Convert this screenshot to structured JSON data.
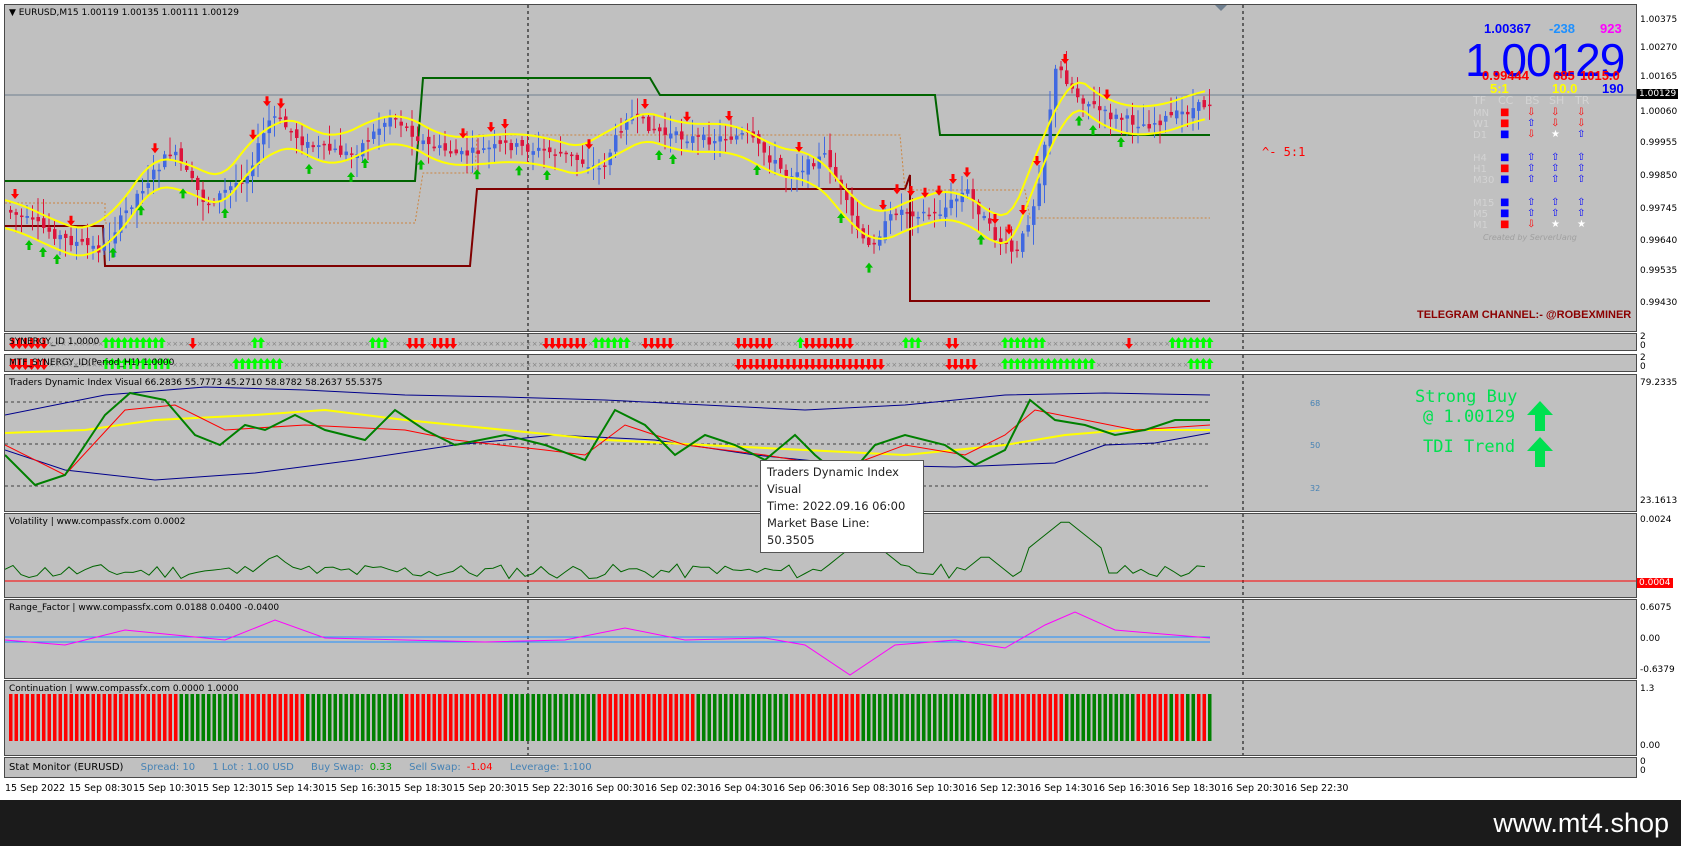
{
  "chart": {
    "title": "EURUSD,M15  1.00119 1.00135 1.00111 1.00129",
    "bid_big": "1.00129",
    "top_left": "1.00367",
    "top_mid": "-238",
    "top_right": "923",
    "row2_left": "0.99444",
    "row2_mid": "685",
    "row2_right": "1015.0",
    "row3_left": "5:1",
    "row3_mid": "10.0",
    "row3_right": "190",
    "ratio_label": "^- 5:1",
    "telegram": "TELEGRAM CHANNEL:- @ROBEXMINER",
    "price_labels": [
      "1.00375",
      "1.00270",
      "1.00165",
      "1.00129",
      "1.00060",
      "0.99955",
      "0.99850",
      "0.99745",
      "0.99640",
      "0.99535",
      "0.99430"
    ],
    "current_price_tag": "1.00129"
  },
  "synergy_matrix": {
    "header": [
      "TF",
      "CC",
      "BS",
      "SH",
      "TR"
    ],
    "rows": [
      "MN",
      "W1",
      "D1",
      "H4",
      "H1",
      "M30",
      "M15",
      "M5",
      "M1"
    ],
    "credit": "Created by ServerUang"
  },
  "panes": {
    "synergy1": {
      "title": "SYNERGY_ID 1.0000",
      "scale": [
        "2",
        "0"
      ]
    },
    "synergy2": {
      "title": "MTF_SYNERGY_ID(Period_H1) 1.0000",
      "scale": [
        "2",
        "0"
      ]
    },
    "tdi": {
      "title": "Traders Dynamic Index Visual 66.2836 55.7773 45.2710 58.8782 58.2637 55.5375",
      "top": "79.2335",
      "bottom": "23.1613",
      "levels": [
        "68",
        "50",
        "32"
      ]
    },
    "volatility": {
      "title": "Volatility | www.compassfx.com   0.0002",
      "top": "0.0024",
      "marker": "0.0004"
    },
    "range": {
      "title": "Range_Factor | www.compassfx.com  0.0188 0.0400 -0.0400",
      "top": "0.6075",
      "mid": "0.00",
      "bottom": "-0.6379"
    },
    "continuation": {
      "title": "Continuation | www.compassfx.com   0.0000 1.0000",
      "top": "1.3",
      "bottom": "0.00"
    },
    "stat": {
      "title": "Stat Monitor (EURUSD)",
      "spread": "Spread:  10",
      "lot": "1 Lot :  1.00 USD",
      "buy_swap_label": "Buy Swap:",
      "buy_swap": "0.33",
      "sell_swap_label": "Sell Swap:",
      "sell_swap": "-1.04",
      "leverage": "Leverage:  1:100",
      "scale": [
        "0",
        "0"
      ]
    }
  },
  "signals": {
    "strong_buy": "Strong Buy",
    "price": "@ 1.00129",
    "trend": "TDI Trend"
  },
  "tooltip": {
    "line1": "Traders Dynamic Index",
    "line2": "Visual",
    "line3": "Time: 2022.09.16 06:00",
    "line4": "Market Base Line: 50.3505"
  },
  "time_axis": [
    "15 Sep 2022",
    "15 Sep 08:30",
    "15 Sep 10:30",
    "15 Sep 12:30",
    "15 Sep 14:30",
    "15 Sep 16:30",
    "15 Sep 18:30",
    "15 Sep 20:30",
    "15 Sep 22:30",
    "16 Sep 00:30",
    "16 Sep 02:30",
    "16 Sep 04:30",
    "16 Sep 06:30",
    "16 Sep 08:30",
    "16 Sep 10:30",
    "16 Sep 12:30",
    "16 Sep 14:30",
    "16 Sep 16:30",
    "16 Sep 18:30",
    "16 Sep 20:30",
    "16 Sep 22:30"
  ],
  "watermark": "www.mt4.shop",
  "colors": {
    "bull": "#4169e1",
    "bear": "#dc143c",
    "yellow": "#ffff00",
    "green": "#006400",
    "darkred": "#800000",
    "tdi_green": "#008000",
    "magenta": "#ff00ff"
  }
}
